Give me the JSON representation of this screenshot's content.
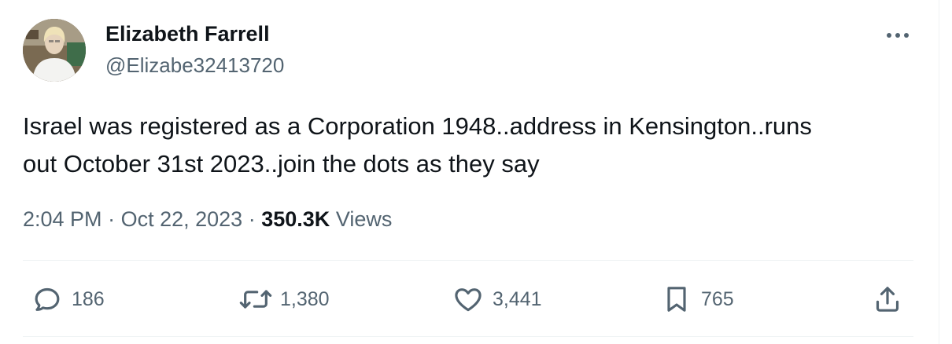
{
  "author": {
    "name": "Elizabeth Farrell",
    "handle": "@Elizabe32413720"
  },
  "tweet": {
    "text_line_1": "Israel was registered as a Corporation 1948..address in Kensington..runs",
    "text_line_2": "out October 31st 2023..join the dots as they say"
  },
  "meta": {
    "time": "2:04 PM",
    "separator": "·",
    "date": "Oct 22, 2023",
    "views_count": "350.3K",
    "views_label": "Views"
  },
  "actions": {
    "replies": "186",
    "reposts": "1,380",
    "likes": "3,441",
    "bookmarks": "765"
  },
  "icons": {
    "more": "more-horizontal-icon",
    "reply": "reply-bubble-icon",
    "repost": "repost-arrows-icon",
    "like": "heart-icon",
    "bookmark": "bookmark-icon",
    "share": "share-upload-icon"
  },
  "colors": {
    "text_primary": "#0f1419",
    "text_secondary": "#536471",
    "divider": "#eff3f4"
  }
}
